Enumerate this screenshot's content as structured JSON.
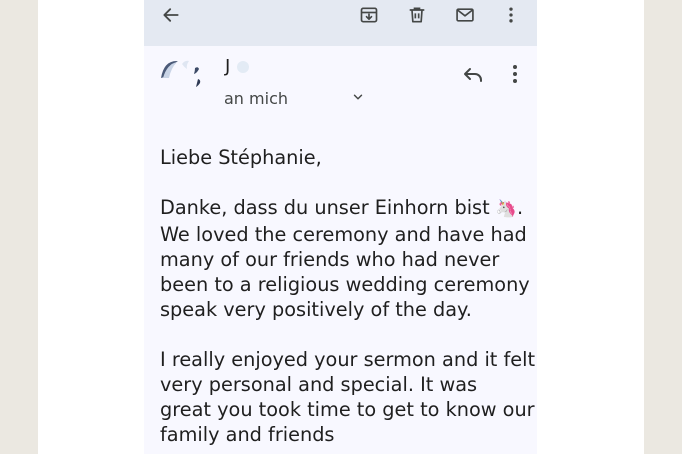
{
  "message": {
    "sender": {
      "name": "J",
      "recipient_label": "an mich"
    },
    "body": {
      "greeting": "Liebe Stéphanie,",
      "paragraph1": {
        "line1": "Danke, dass du unser Einhorn bist",
        "emoji": "🦄",
        "line1_end": ".",
        "lines": [
          "We loved the ceremony and have had",
          "many of our friends who had never",
          "been to a religious wedding ceremony",
          "speak very positively of the day."
        ]
      },
      "paragraph2": {
        "lines": [
          "I really enjoyed your sermon and it felt",
          "very personal and special. It was",
          "great you took time to get to know our",
          "family and friends"
        ]
      }
    }
  },
  "icons": {
    "back": "arrow-left-icon",
    "archive": "archive-icon",
    "delete": "trash-icon",
    "mark_unread": "mail-icon",
    "more": "more-vertical-icon",
    "reply": "reply-icon",
    "details": "chevron-down-icon"
  },
  "colors": {
    "toolbar_bg": "#e4e9f2",
    "page_bg": "#f8f8ff",
    "text": "#1f1f1f",
    "secondary_text": "#444746",
    "icon": "#444746"
  }
}
